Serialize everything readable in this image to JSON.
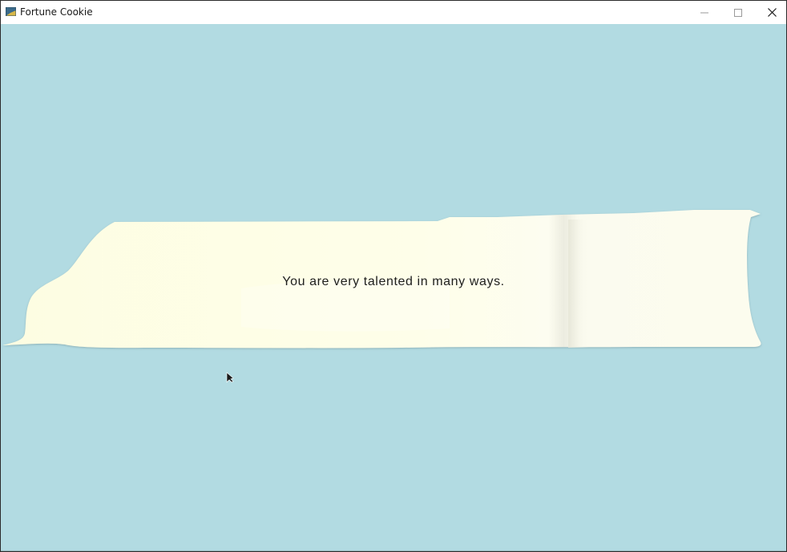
{
  "window": {
    "title": "Fortune Cookie",
    "background_color": "#b2dbe2",
    "controls": {
      "minimize_icon": "minimize-icon",
      "maximize_icon": "maximize-icon",
      "close_icon": "close-icon"
    }
  },
  "fortune": {
    "message": "You are very talented in many ways.",
    "paper_color": "#fdfde8"
  }
}
